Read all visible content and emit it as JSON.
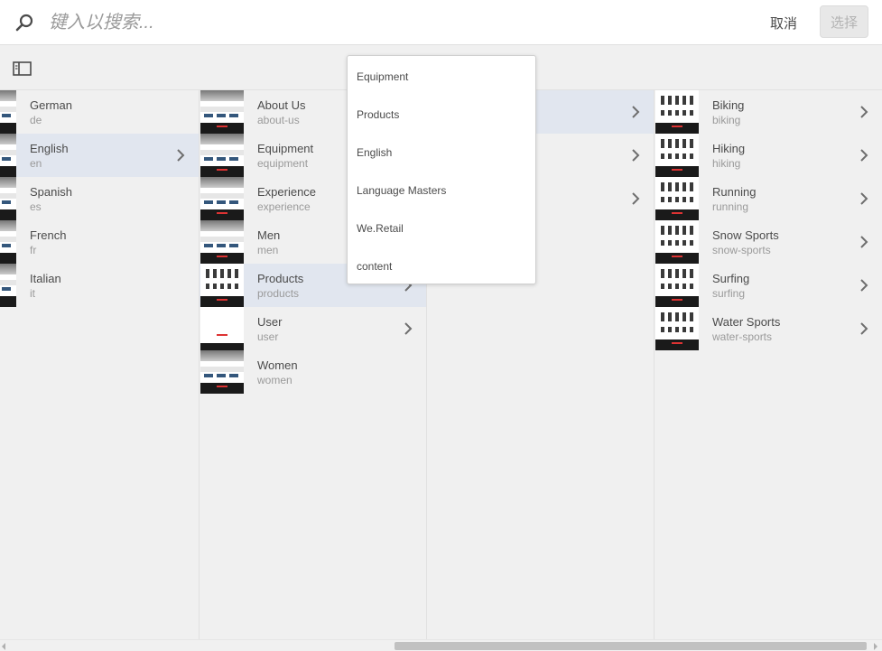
{
  "search": {
    "placeholder": "键入以搜索...",
    "value": ""
  },
  "header": {
    "cancel_label": "取消",
    "select_label": "选择"
  },
  "column1": {
    "items": [
      {
        "title": "German",
        "sub": "de",
        "has_children": false,
        "active": false
      },
      {
        "title": "English",
        "sub": "en",
        "has_children": true,
        "active": true
      },
      {
        "title": "Spanish",
        "sub": "es",
        "has_children": false,
        "active": false
      },
      {
        "title": "French",
        "sub": "fr",
        "has_children": false,
        "active": false
      },
      {
        "title": "Italian",
        "sub": "it",
        "has_children": false,
        "active": false
      }
    ]
  },
  "column2": {
    "items": [
      {
        "title": "About Us",
        "sub": "about-us",
        "has_children": false,
        "active": false
      },
      {
        "title": "Equipment",
        "sub": "equipment",
        "has_children": false,
        "active": false
      },
      {
        "title": "Experience",
        "sub": "experience",
        "has_children": false,
        "active": false
      },
      {
        "title": "Men",
        "sub": "men",
        "has_children": false,
        "active": false
      },
      {
        "title": "Products",
        "sub": "products",
        "has_children": true,
        "active": true
      },
      {
        "title": "User",
        "sub": "user",
        "has_children": true,
        "active": false
      },
      {
        "title": "Women",
        "sub": "women",
        "has_children": false,
        "active": false
      }
    ]
  },
  "column3": {
    "items": [
      {
        "title": "",
        "sub": "",
        "has_children": true,
        "active": true
      },
      {
        "title": "",
        "sub": "",
        "has_children": true,
        "active": false
      },
      {
        "title": "",
        "sub": "",
        "has_children": true,
        "active": false
      }
    ]
  },
  "column4": {
    "items": [
      {
        "title": "Biking",
        "sub": "biking",
        "has_children": true
      },
      {
        "title": "Hiking",
        "sub": "hiking",
        "has_children": true
      },
      {
        "title": "Running",
        "sub": "running",
        "has_children": true
      },
      {
        "title": "Snow Sports",
        "sub": "snow-sports",
        "has_children": true
      },
      {
        "title": "Surfing",
        "sub": "surfing",
        "has_children": true
      },
      {
        "title": "Water Sports",
        "sub": "water-sports",
        "has_children": true
      }
    ]
  },
  "breadcrumb_dropdown": {
    "items": [
      "Equipment",
      "Products",
      "English",
      "Language Masters",
      "We.Retail",
      "content"
    ]
  },
  "colors": {
    "accent_row": "#e1e6ef",
    "background": "#f0f0f0"
  }
}
